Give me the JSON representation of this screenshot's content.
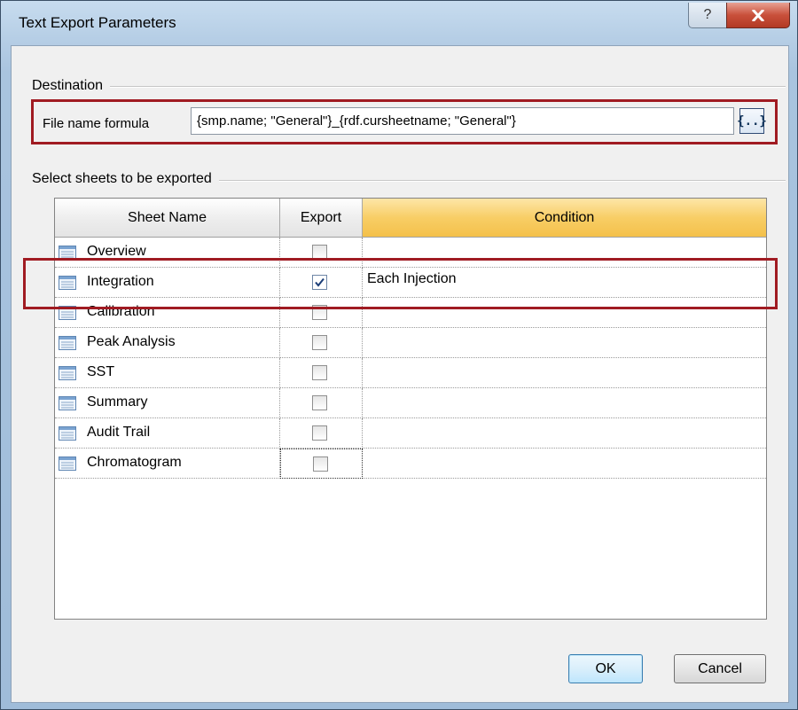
{
  "window": {
    "title": "Text Export Parameters",
    "help_glyph": "?"
  },
  "destination": {
    "caption": "Destination",
    "file_label": "File name formula",
    "formula_value": "{smp.name; \"General\"}_{rdf.cursheetname; \"General\"}",
    "formula_button": "{..}"
  },
  "sheets": {
    "caption": "Select sheets to be exported",
    "columns": [
      "Sheet Name",
      "Export",
      "Condition"
    ],
    "rows": [
      {
        "name": "Overview",
        "export": false,
        "condition": ""
      },
      {
        "name": "Integration",
        "export": true,
        "condition": "Each Injection"
      },
      {
        "name": "Calibration",
        "export": false,
        "condition": ""
      },
      {
        "name": "Peak Analysis",
        "export": false,
        "condition": ""
      },
      {
        "name": "SST",
        "export": false,
        "condition": ""
      },
      {
        "name": "Summary",
        "export": false,
        "condition": ""
      },
      {
        "name": "Audit Trail",
        "export": false,
        "condition": ""
      },
      {
        "name": "Chromatogram",
        "export": false,
        "condition": ""
      }
    ]
  },
  "buttons": {
    "ok": "OK",
    "cancel": "Cancel"
  },
  "colors": {
    "highlight": "#a01b22",
    "condition_header": "#f8ce66"
  }
}
